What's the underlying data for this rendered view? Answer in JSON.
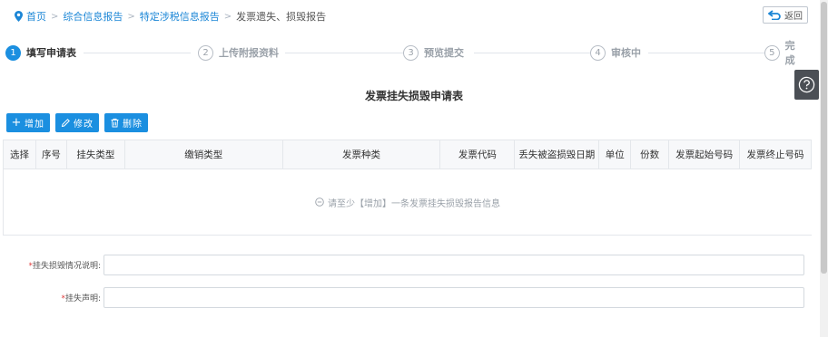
{
  "breadcrumb": {
    "home": "首页",
    "level1": "综合信息报告",
    "level2": "特定涉税信息报告",
    "current": "发票遗失、损毁报告",
    "separator": ">"
  },
  "back_button": {
    "label": "返回"
  },
  "steps": [
    {
      "num": "1",
      "label": "填写申请表",
      "active": true
    },
    {
      "num": "2",
      "label": "上传附报资料",
      "active": false
    },
    {
      "num": "3",
      "label": "预览提交",
      "active": false
    },
    {
      "num": "4",
      "label": "审核中",
      "active": false
    },
    {
      "num": "5",
      "label": "完成",
      "active": false
    }
  ],
  "help": {
    "icon": "question-circle-icon"
  },
  "form_title": "发票挂失损毁申请表",
  "toolbar": {
    "add_icon": "+",
    "add_label": "增加",
    "edit_label": "修改",
    "delete_label": "删除"
  },
  "table": {
    "columns": [
      "选择",
      "序号",
      "挂失类型",
      "缴销类型",
      "发票种类",
      "发票代码",
      "丢失被盗损毁日期",
      "单位",
      "份数",
      "发票起始号码",
      "发票终止号码"
    ],
    "empty_text": "请至少【增加】一条发票挂失损毁报告信息"
  },
  "fields": {
    "explanation": {
      "required_mark": "*",
      "label": "挂失损毁情况说明:",
      "value": ""
    },
    "statement": {
      "required_mark": "*",
      "label": "挂失声明:",
      "value": ""
    }
  },
  "colors": {
    "accent": "#1b8fe0",
    "link": "#1b86d6",
    "required": "#e03c3c"
  }
}
